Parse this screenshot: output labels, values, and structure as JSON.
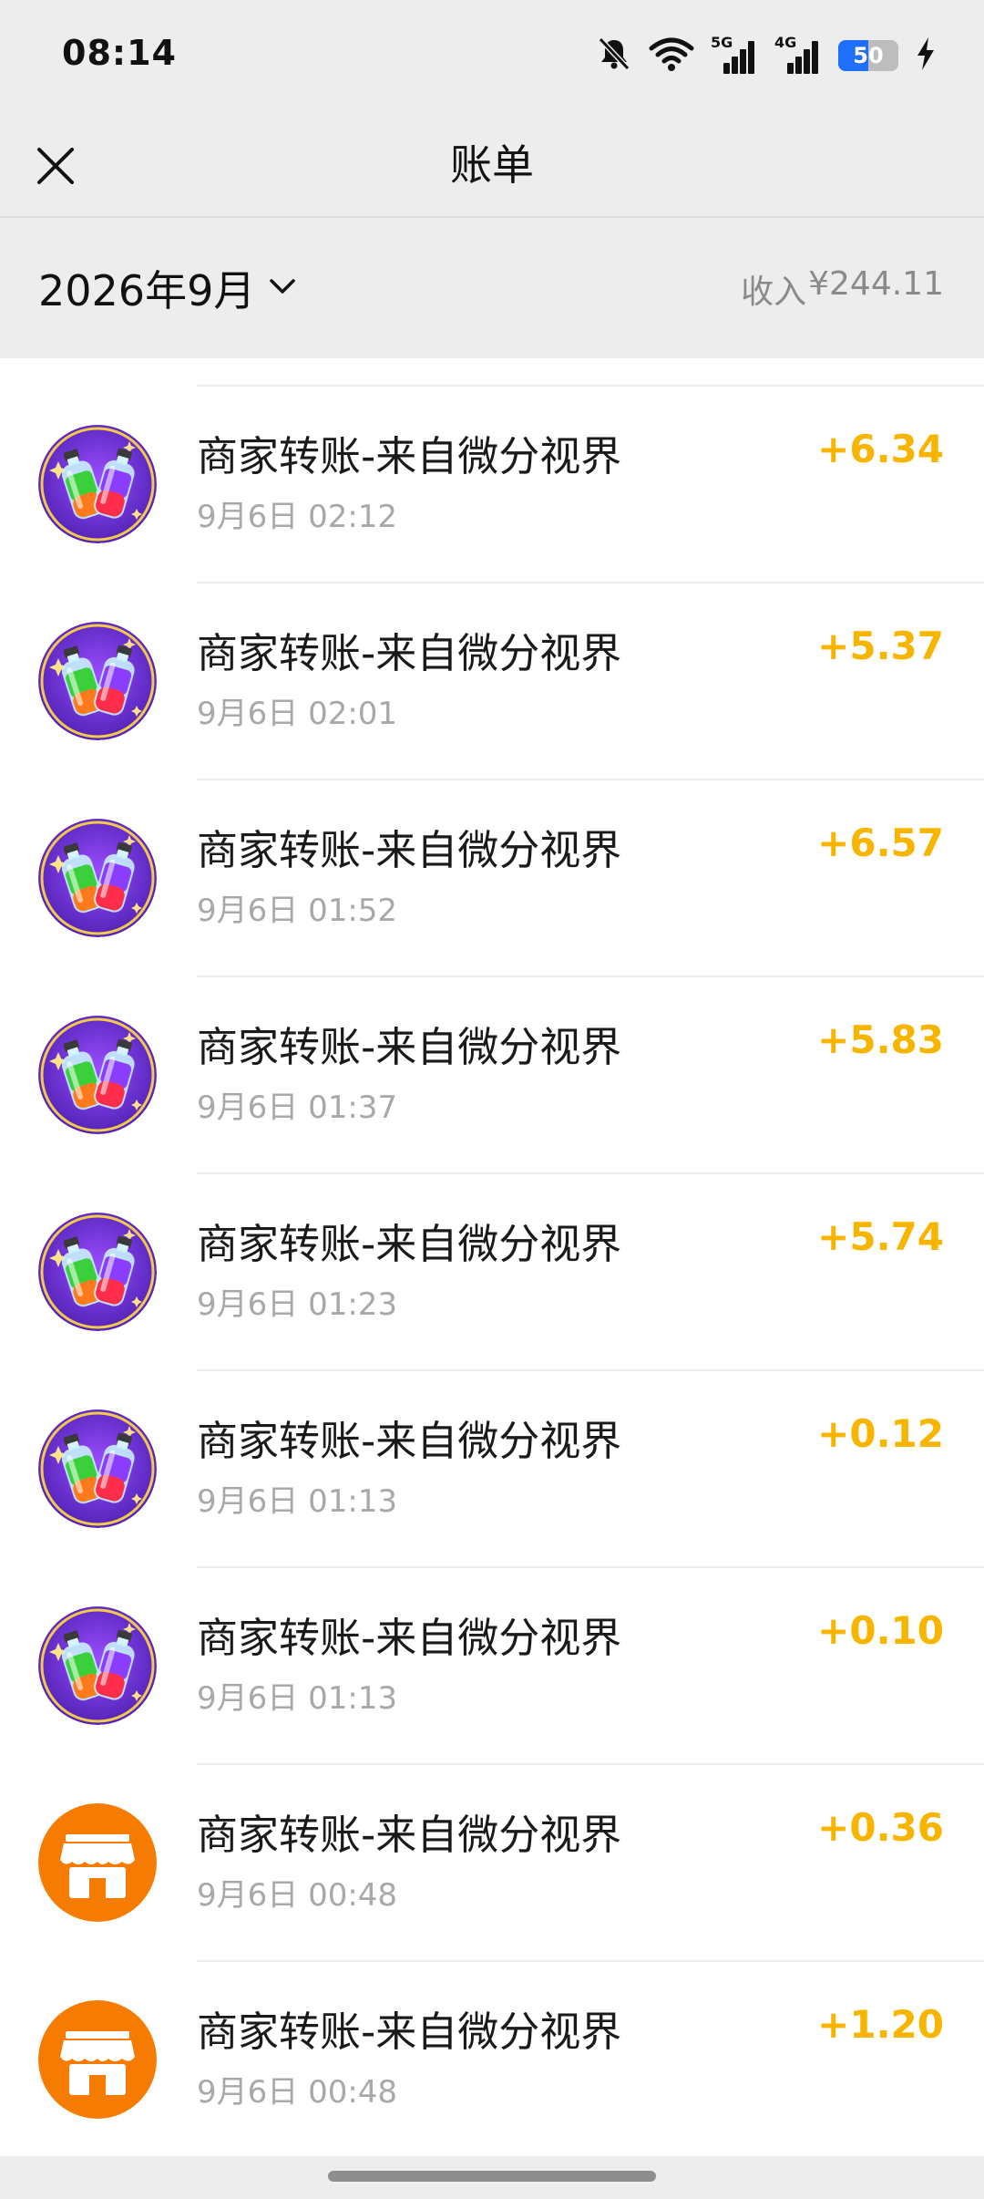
{
  "status_bar": {
    "time": "08:14",
    "icons": [
      "bell-muted-icon",
      "wifi-icon",
      "signal-5g-icon",
      "signal-4g-icon",
      "battery-icon",
      "charging-icon"
    ],
    "net_a": "5G",
    "net_b": "4G",
    "battery_percent": "50",
    "battery_level": 0.5
  },
  "nav": {
    "title": "账单",
    "close_icon": "close-icon"
  },
  "month_header": {
    "month": "2026年9月",
    "dropdown_icon": "chevron-down-icon",
    "income_label": "收入",
    "income_amount": "¥244.11"
  },
  "transactions": [
    {
      "title": "商家转账-来自微分视界",
      "time": "9月6日 02:12",
      "amount": "+6.34",
      "avatar": "potion-bottles-icon"
    },
    {
      "title": "商家转账-来自微分视界",
      "time": "9月6日 02:01",
      "amount": "+5.37",
      "avatar": "potion-bottles-icon"
    },
    {
      "title": "商家转账-来自微分视界",
      "time": "9月6日 01:52",
      "amount": "+6.57",
      "avatar": "potion-bottles-icon"
    },
    {
      "title": "商家转账-来自微分视界",
      "time": "9月6日 01:37",
      "amount": "+5.83",
      "avatar": "potion-bottles-icon"
    },
    {
      "title": "商家转账-来自微分视界",
      "time": "9月6日 01:23",
      "amount": "+5.74",
      "avatar": "potion-bottles-icon"
    },
    {
      "title": "商家转账-来自微分视界",
      "time": "9月6日 01:13",
      "amount": "+0.12",
      "avatar": "potion-bottles-icon"
    },
    {
      "title": "商家转账-来自微分视界",
      "time": "9月6日 01:13",
      "amount": "+0.10",
      "avatar": "potion-bottles-icon"
    },
    {
      "title": "商家转账-来自微分视界",
      "time": "9月6日 00:48",
      "amount": "+0.36",
      "avatar": "shop-icon"
    },
    {
      "title": "商家转账-来自微分视界",
      "time": "9月6日 00:48",
      "amount": "+1.20",
      "avatar": "shop-icon"
    }
  ],
  "colors": {
    "background": "#ededed",
    "list_background": "#ffffff",
    "amount": "#f7b500",
    "secondary_text": "#a8a8a8",
    "shop_avatar": "#f57c00",
    "battery_fill": "#1f6fff"
  }
}
